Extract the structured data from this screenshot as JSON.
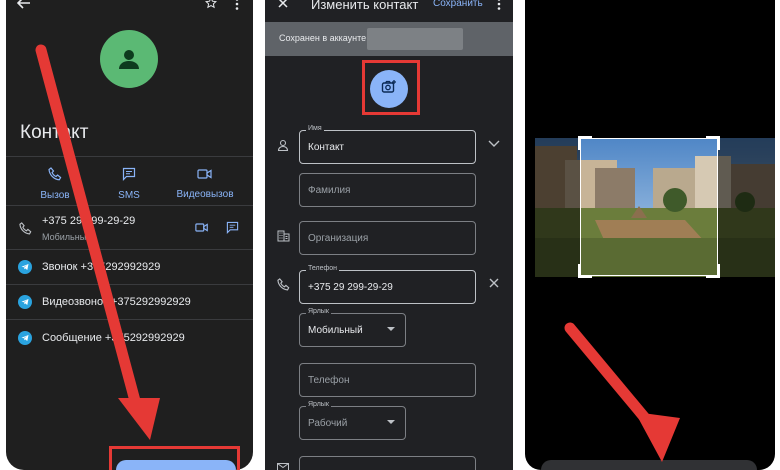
{
  "colors": {
    "phone_bg": "#1f1f1f",
    "accent_blue": "#8ab4f8",
    "avatar_green": "#5bb974",
    "telegram_blue": "#2aa3df",
    "annotation_red": "#e53935"
  },
  "screen1": {
    "top_icons": [
      "arrow-left-icon",
      "star-icon",
      "more-vert-icon"
    ],
    "avatar_icon": "person-icon",
    "contact_name": "Контакт",
    "actions": [
      {
        "icon": "phone-icon",
        "label": "Вызов"
      },
      {
        "icon": "message-icon",
        "label": "SMS"
      },
      {
        "icon": "video-icon",
        "label": "Видеовызов"
      }
    ],
    "phone_number": "+375 29 299-29-29",
    "phone_type": "Мобильный",
    "telegram_rows": [
      "Звонок +375292992929",
      "Видеозвонок +375292992929",
      "Сообщение +375292992929"
    ]
  },
  "screen2": {
    "title": "Изменить контакт",
    "save_label": "Сохранить",
    "account_text": "Сохранен в аккаунте",
    "photo_icon": "add-photo-icon",
    "name_label": "Имя",
    "name_value": "Контакт",
    "surname_placeholder": "Фамилия",
    "company_placeholder": "Организация",
    "phone_label": "Телефон",
    "phone_value": "+375 29 299-29-29",
    "label_label": "Ярлык",
    "label_value": "Мобильный",
    "phone2_placeholder": "Телефон",
    "label2_label": "Ярлык",
    "label2_value": "Рабочий"
  },
  "screen3": {
    "image": "crop-photo-courtyard"
  }
}
